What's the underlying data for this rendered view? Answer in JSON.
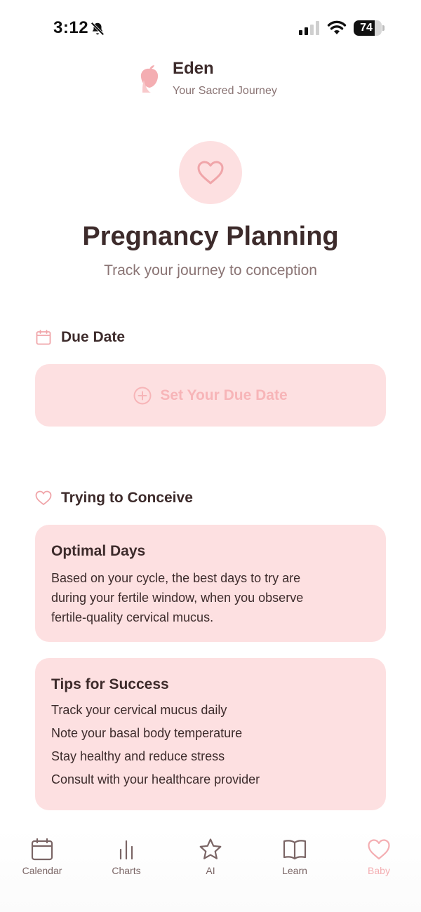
{
  "status_bar": {
    "time": "3:12",
    "battery_percent": 74,
    "battery_label": "74"
  },
  "header": {
    "app_name": "Eden",
    "tagline": "Your Sacred Journey"
  },
  "hero": {
    "title": "Pregnancy Planning",
    "subtitle": "Track your journey to conception"
  },
  "due_date": {
    "section_title": "Due Date",
    "button_label": "Set Your Due Date"
  },
  "ttc": {
    "section_title": "Trying to Conceive",
    "optimal_days": {
      "title": "Optimal Days",
      "lines": [
        "Based on your cycle, the best days to try are",
        "during your fertile window, when you observe",
        "fertile-quality cervical mucus."
      ]
    },
    "tips": {
      "title": "Tips for Success",
      "items": [
        "Track your cervical mucus daily",
        "Note your basal body temperature",
        "Stay healthy and reduce stress",
        "Consult with your healthcare provider"
      ]
    }
  },
  "nav": {
    "items": [
      {
        "label": "Calendar",
        "icon": "calendar-icon"
      },
      {
        "label": "Charts",
        "icon": "bar-chart-icon"
      },
      {
        "label": "AI",
        "icon": "star-icon"
      },
      {
        "label": "Learn",
        "icon": "book-icon"
      },
      {
        "label": "Baby",
        "icon": "heart-icon"
      }
    ],
    "active": "Baby"
  },
  "colors": {
    "accent": "#f4aeb2",
    "card_background": "#fde0e1",
    "text_primary": "#3d2b2b",
    "text_secondary": "#8a7474"
  }
}
